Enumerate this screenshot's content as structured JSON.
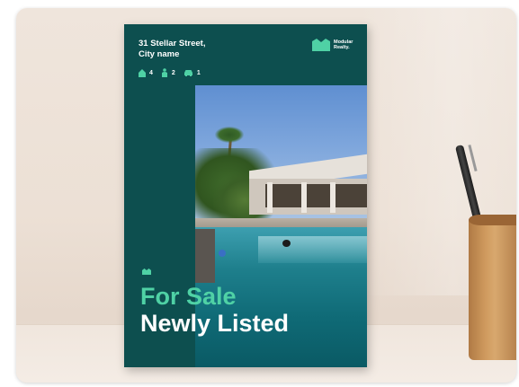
{
  "poster": {
    "address_line1": "31 Stellar Street,",
    "address_line2": "City name",
    "stats": [
      {
        "icon": "house-icon",
        "value": "4"
      },
      {
        "icon": "person-icon",
        "value": "2"
      },
      {
        "icon": "car-icon",
        "value": "1"
      }
    ],
    "brand_line1": "Modular",
    "brand_line2": "Realty.",
    "headline_primary": "For Sale",
    "headline_secondary": "Newly Listed"
  },
  "colors": {
    "poster_background": "#0d4f4f",
    "accent_green": "#4fd1a5",
    "text_white": "#ffffff"
  }
}
